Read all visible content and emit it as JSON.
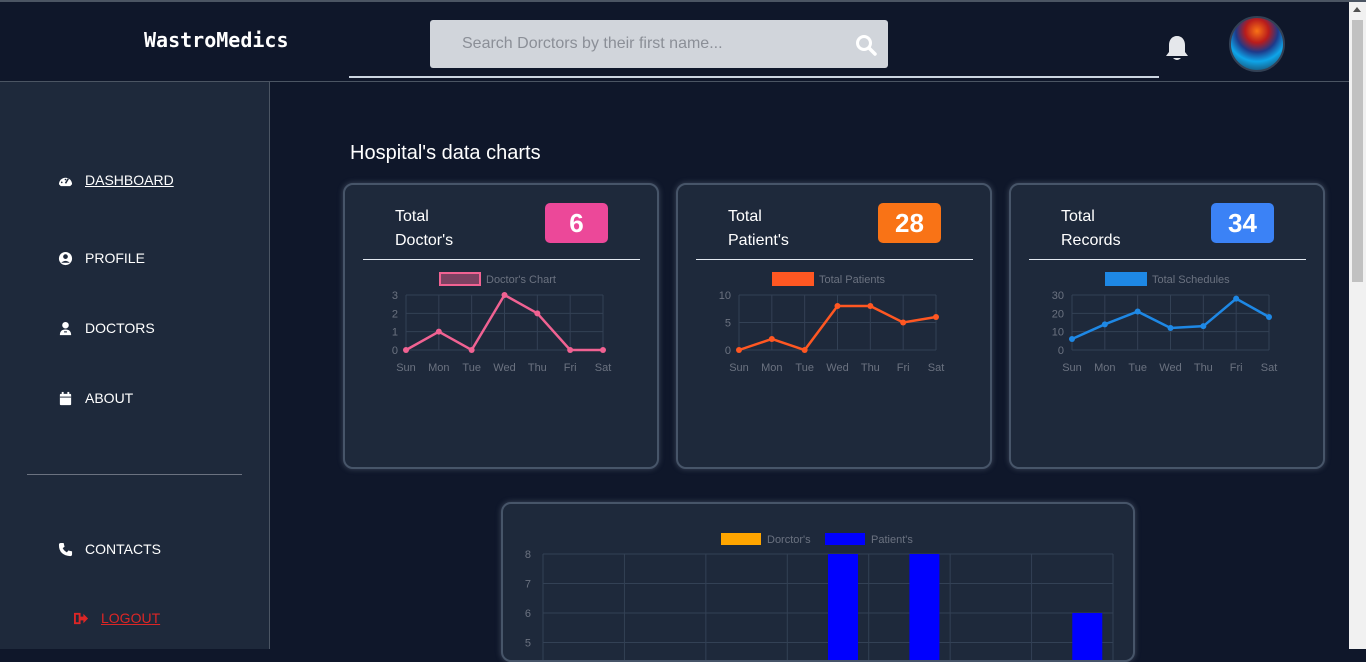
{
  "app": {
    "brand": "WastroMedics"
  },
  "search": {
    "placeholder": "Search Dorctors by their first name..."
  },
  "sidebar": {
    "items": [
      {
        "label": "DASHBOARD",
        "icon": "dashboard-icon"
      },
      {
        "label": "PROFILE",
        "icon": "user-circle-icon"
      },
      {
        "label": "DOCTORS",
        "icon": "doctor-icon"
      },
      {
        "label": "ABOUT",
        "icon": "calendar-icon"
      },
      {
        "label": "CONTACTS",
        "icon": "phone-icon"
      }
    ],
    "logout": "LOGOUT"
  },
  "main": {
    "title": "Hospital's data charts"
  },
  "colors": {
    "doctors": "#ec4899",
    "patients": "#f97316",
    "records": "#3b82f6",
    "doctors_line": "#f06292",
    "patients_line": "#ff5722",
    "records_line": "#1e88e5",
    "bar_doctors": "#ffa500",
    "bar_patients": "#0000ff",
    "logout": "#dc2626"
  },
  "cards": [
    {
      "label_line1": "Total",
      "label_line2": "Doctor's",
      "value": "6"
    },
    {
      "label_line1": "Total",
      "label_line2": "Patient's",
      "value": "28"
    },
    {
      "label_line1": "Total",
      "label_line2": "Records",
      "value": "34"
    }
  ],
  "chart_data": [
    {
      "type": "line",
      "x": [
        "Sun",
        "Mon",
        "Tue",
        "Wed",
        "Thu",
        "Fri",
        "Sat"
      ],
      "series": [
        {
          "name": "Doctor's Chart",
          "values": [
            0,
            1,
            0,
            3,
            2,
            0,
            0
          ]
        }
      ],
      "ylim": [
        0,
        3
      ],
      "yticks": [
        0,
        1,
        2,
        3
      ],
      "legend": "top-center",
      "grid": true
    },
    {
      "type": "line",
      "x": [
        "Sun",
        "Mon",
        "Tue",
        "Wed",
        "Thu",
        "Fri",
        "Sat"
      ],
      "series": [
        {
          "name": "Total Patients",
          "values": [
            0,
            2,
            0,
            8,
            8,
            5,
            6
          ]
        }
      ],
      "ylim": [
        0,
        10
      ],
      "yticks": [
        0,
        5,
        10
      ],
      "legend": "top-center",
      "grid": true
    },
    {
      "type": "line",
      "x": [
        "Sun",
        "Mon",
        "Tue",
        "Wed",
        "Thu",
        "Fri",
        "Sat"
      ],
      "series": [
        {
          "name": "Total Schedules",
          "values": [
            6,
            14,
            21,
            12,
            13,
            28,
            18
          ]
        }
      ],
      "ylim": [
        0,
        30
      ],
      "yticks": [
        0,
        10,
        20,
        30
      ],
      "legend": "top-center",
      "grid": true
    },
    {
      "type": "bar",
      "categories": [
        "",
        "",
        "",
        "",
        "",
        "",
        ""
      ],
      "series": [
        {
          "name": "Dorctor's",
          "values": [
            0,
            0,
            0,
            0,
            0,
            0,
            0
          ]
        },
        {
          "name": "Patient's",
          "values": [
            0,
            0,
            0,
            8,
            8,
            5,
            6
          ]
        }
      ],
      "ylim": [
        5,
        8
      ],
      "yticks": [
        5,
        6,
        7,
        8
      ],
      "legend": "top-center",
      "grid": true
    }
  ]
}
